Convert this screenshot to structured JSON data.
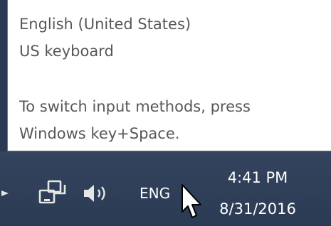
{
  "tooltip": {
    "language": "English (United States)",
    "keyboard": "US keyboard",
    "hint_line1": "To switch input methods, press",
    "hint_line2": "Windows key+Space."
  },
  "taskbar": {
    "icons": [
      "show-hidden-icons-arrow",
      "network-icon",
      "volume-icon"
    ],
    "input_indicator": "ENG",
    "clock": {
      "time": "4:41 PM",
      "date": "8/31/2016"
    }
  },
  "colors": {
    "tooltip_bg": "#ffffff",
    "tooltip_text": "#575757",
    "taskbar_bg": "#2f3e57",
    "taskbar_text": "#ffffff"
  }
}
